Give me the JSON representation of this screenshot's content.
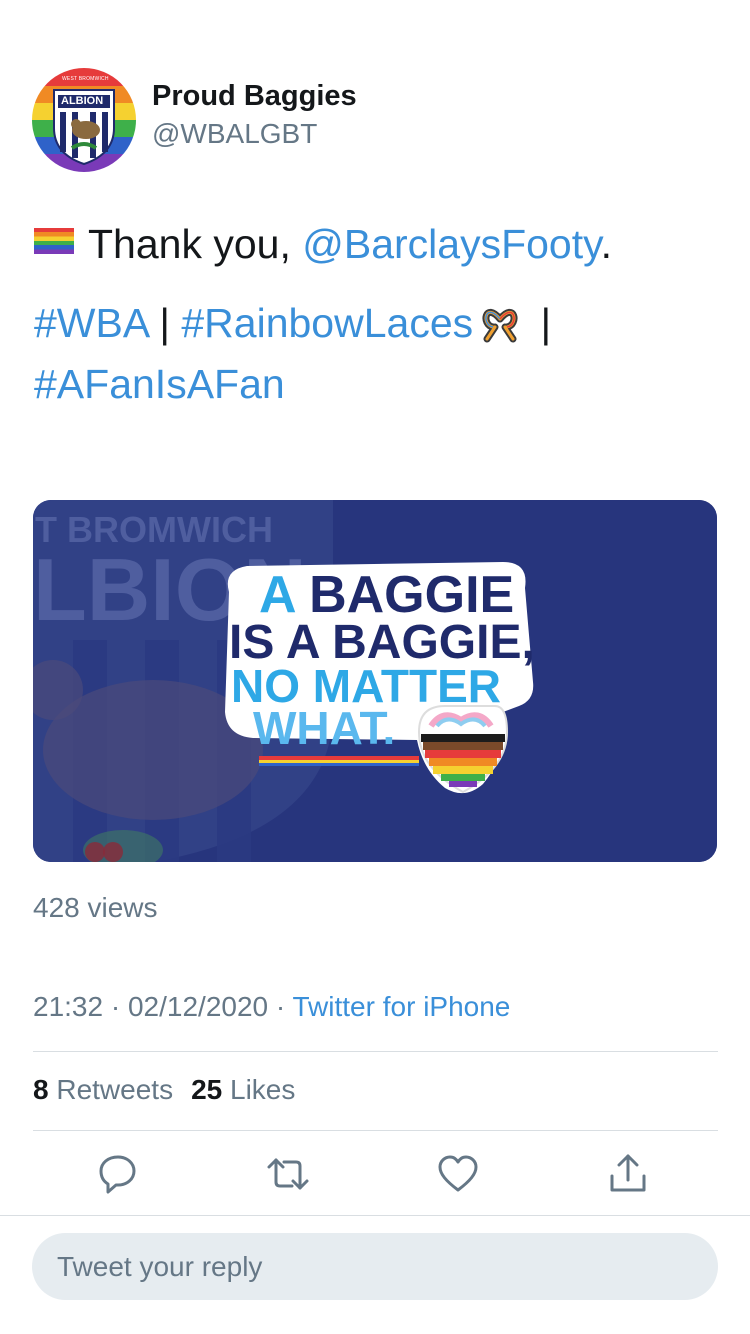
{
  "tweet": {
    "display_name": "Proud Baggies",
    "handle": "@WBALGBT",
    "avatar_icon": "west-bromwich-albion-rainbow-crest",
    "avatar_text": {
      "top": "WEST BROMWICH",
      "main": "ALBION"
    },
    "text": {
      "line1_emoji": "rainbow-flag",
      "line1_text": "Thank you, ",
      "line1_mention": "@BarclaysFooty",
      "line1_end": ".",
      "line2_tag1": "#WBA",
      "line2_sep1": " | ",
      "line2_tag2": "#RainbowLaces",
      "line2_emoji": "rainbow-laces",
      "line2_sep2": " |",
      "line3_tag": "#AFanIsAFan"
    },
    "media": {
      "bg_text_1": "T BROMWICH",
      "bg_text_2": "LBION",
      "headline_1a": "A ",
      "headline_1b": "BAGGIE",
      "headline_2": "IS A BAGGIE,",
      "headline_3": "NO MATTER",
      "headline_4": "WHAT.",
      "colors": {
        "background": "#27357d",
        "headline_blue": "#2ea8e6",
        "headline_navy": "#1f2a6b"
      }
    },
    "views": "428 views",
    "time": "21:32",
    "date": "02/12/2020",
    "separator": " · ",
    "source": "Twitter for iPhone",
    "retweets_count": "8",
    "retweets_label": "Retweets",
    "likes_count": "25",
    "likes_label": "Likes"
  },
  "actions": [
    {
      "icon": "reply-icon"
    },
    {
      "icon": "retweet-icon"
    },
    {
      "icon": "like-icon"
    },
    {
      "icon": "share-icon"
    }
  ],
  "reply": {
    "placeholder": "Tweet your reply"
  },
  "colors": {
    "link": "#3a8fd9",
    "muted": "#657786",
    "text": "#14171a",
    "reply_bg": "#e6ecf0"
  }
}
